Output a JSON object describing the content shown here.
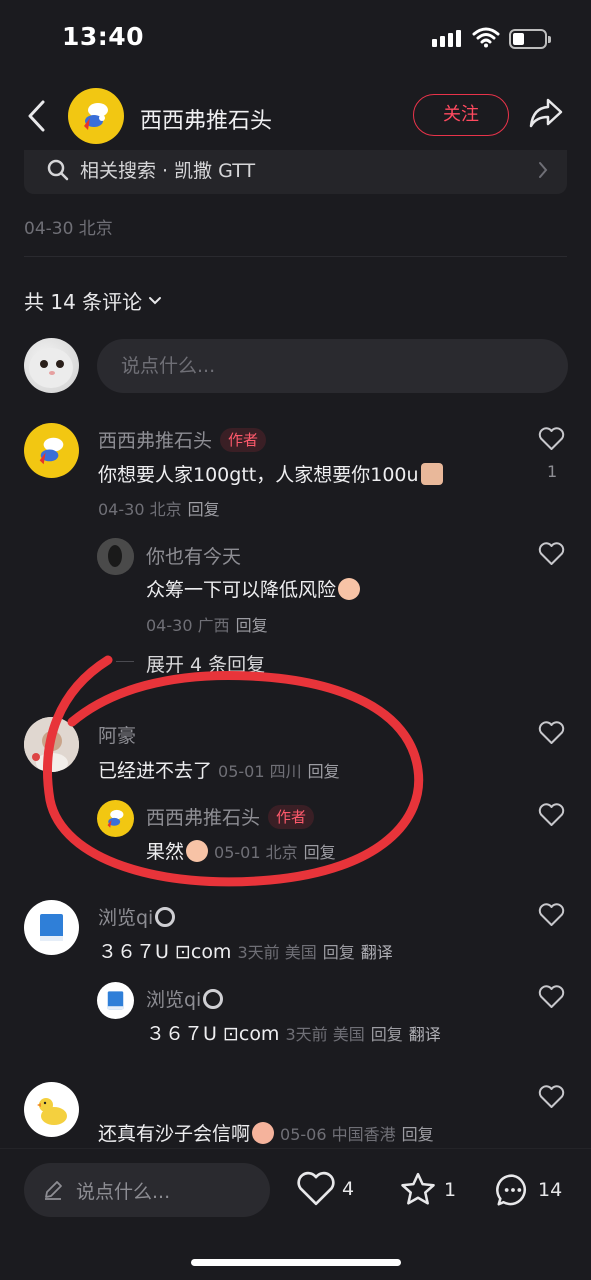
{
  "status_bar": {
    "time": "13:40"
  },
  "nav": {
    "title": "西西弗推石头",
    "follow_label": "关注"
  },
  "related_search": {
    "text": "相关搜索 · 凯撒 GTT"
  },
  "post_meta": "04-30 北京",
  "comments_count_label": "共 14 条评论",
  "comment_input": {
    "placeholder": "说点什么..."
  },
  "comments": [
    {
      "name": "西西弗推石头",
      "tag": "作者",
      "text": "你想要人家100gtt，人家想要你100u",
      "meta": "04-30 北京",
      "reply": "回复",
      "likes": "1",
      "replies": [
        {
          "name": "你也有今天",
          "text": "众筹一下可以降低风险",
          "meta": "04-30 广西",
          "reply": "回复"
        }
      ],
      "expand_label": "展开 4 条回复"
    },
    {
      "name": "阿豪",
      "text": "已经进不去了",
      "meta": "05-01 四川",
      "reply": "回复",
      "replies": [
        {
          "name": "西西弗推石头",
          "tag": "作者",
          "text": "果然",
          "meta": "05-01 北京",
          "reply": "回复"
        }
      ]
    },
    {
      "name": "浏览qi",
      "text": "３６７U ⊡com",
      "meta": "3天前 美国",
      "reply": "回复",
      "translate": "翻译",
      "replies": [
        {
          "name": "浏览qi",
          "text": "３６７U ⊡com",
          "meta": "3天前 美国",
          "reply": "回复",
          "translate": "翻译"
        }
      ]
    },
    {
      "name": "",
      "text": "还真有沙子会信啊",
      "meta": "05-06 中国香港",
      "reply": "回复"
    }
  ],
  "bottom_bar": {
    "input_placeholder": "说点什么...",
    "likes": "4",
    "stars": "1",
    "comments": "14"
  },
  "colors": {
    "background": "#1b1b1f",
    "accent": "#ff4a5f",
    "annotation": "#e8343a"
  }
}
